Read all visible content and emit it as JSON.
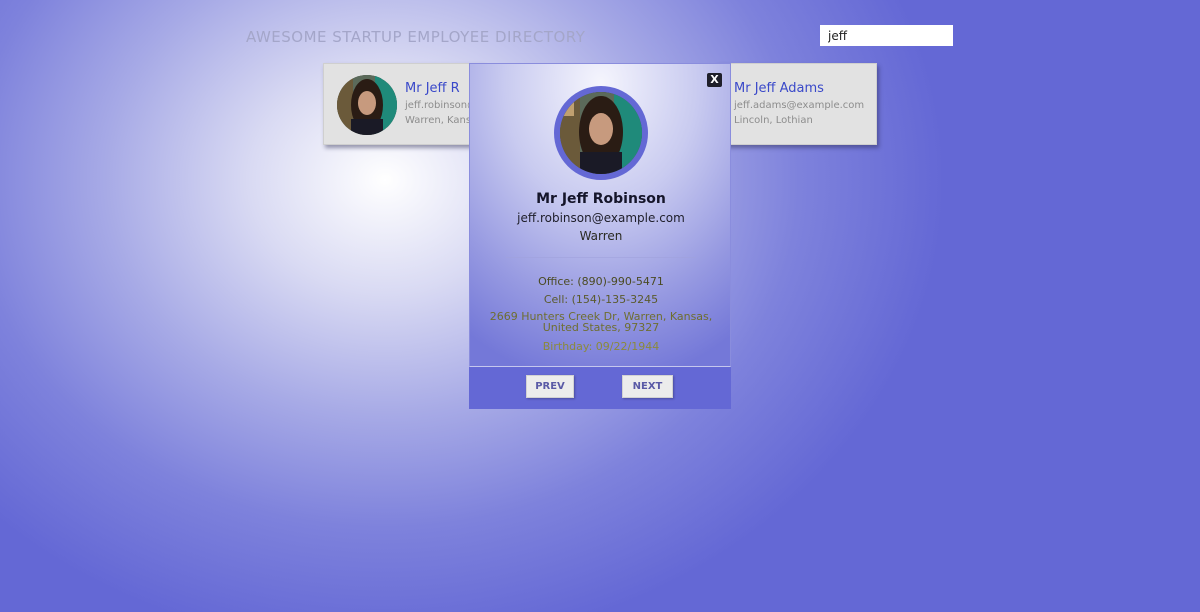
{
  "header": {
    "title": "Awesome Startup Employee Directory"
  },
  "search": {
    "value": "jeff"
  },
  "cards": [
    {
      "name": "Mr Jeff R",
      "email": "jeff.robinson@",
      "location": "Warren, Kansa"
    },
    {
      "name": "Mr Jeff Adams",
      "email": "jeff.adams@example.com",
      "location": "Lincoln, Lothian"
    }
  ],
  "modal": {
    "close_label": "X",
    "name": "Mr Jeff Robinson",
    "email": "jeff.robinson@example.com",
    "city": "Warren",
    "office": "Office: (890)-990-5471",
    "cell": "Cell: (154)-135-3245",
    "address": "2669 Hunters Creek Dr, Warren, Kansas, United States, 97327",
    "birthday": "Birthday: 09/22/1944",
    "prev_label": "Prev",
    "next_label": "Next"
  },
  "colors": {
    "accent": "#6468d5",
    "name_link": "#3a49c9"
  },
  "icons": {
    "close": "close-icon",
    "avatar": "avatar-photo"
  }
}
